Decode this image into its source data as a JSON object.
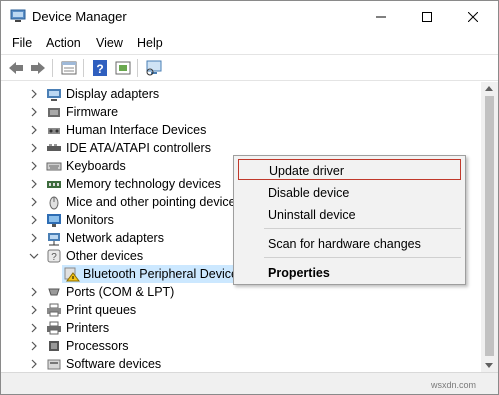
{
  "window": {
    "title": "Device Manager"
  },
  "menu": [
    "File",
    "Action",
    "View",
    "Help"
  ],
  "toolbar": {
    "icons": [
      "back-arrow-icon",
      "forward-arrow-icon",
      "properties-icon",
      "help-icon",
      "update-driver-icon",
      "scan-hardware-icon"
    ]
  },
  "tree": [
    {
      "label": "Display adapters",
      "icon": "display-adapter-icon"
    },
    {
      "label": "Firmware",
      "icon": "firmware-icon"
    },
    {
      "label": "Human Interface Devices",
      "icon": "hid-icon"
    },
    {
      "label": "IDE ATA/ATAPI controllers",
      "icon": "ide-controller-icon"
    },
    {
      "label": "Keyboards",
      "icon": "keyboard-icon"
    },
    {
      "label": "Memory technology devices",
      "icon": "memory-icon"
    },
    {
      "label": "Mice and other pointing devices",
      "icon": "mouse-icon"
    },
    {
      "label": "Monitors",
      "icon": "monitor-icon"
    },
    {
      "label": "Network adapters",
      "icon": "network-icon"
    },
    {
      "label": "Other devices",
      "icon": "other-devices-icon",
      "expanded": true
    },
    {
      "label": "Bluetooth Peripheral Device",
      "icon": "warning-device-icon",
      "child": true,
      "selected": true
    },
    {
      "label": "Ports (COM & LPT)",
      "icon": "port-icon"
    },
    {
      "label": "Print queues",
      "icon": "printer-icon"
    },
    {
      "label": "Printers",
      "icon": "printer-icon"
    },
    {
      "label": "Processors",
      "icon": "processor-icon"
    },
    {
      "label": "Software devices",
      "icon": "software-icon"
    }
  ],
  "context_menu": {
    "update_driver": "Update driver",
    "disable_device": "Disable device",
    "uninstall_device": "Uninstall device",
    "scan_hardware": "Scan for hardware changes",
    "properties": "Properties"
  },
  "watermark": "wsxdn.com",
  "colors": {
    "selection": "#cce8ff",
    "highlight_border": "#c0392b",
    "menu_bg": "#f2f2f2"
  }
}
